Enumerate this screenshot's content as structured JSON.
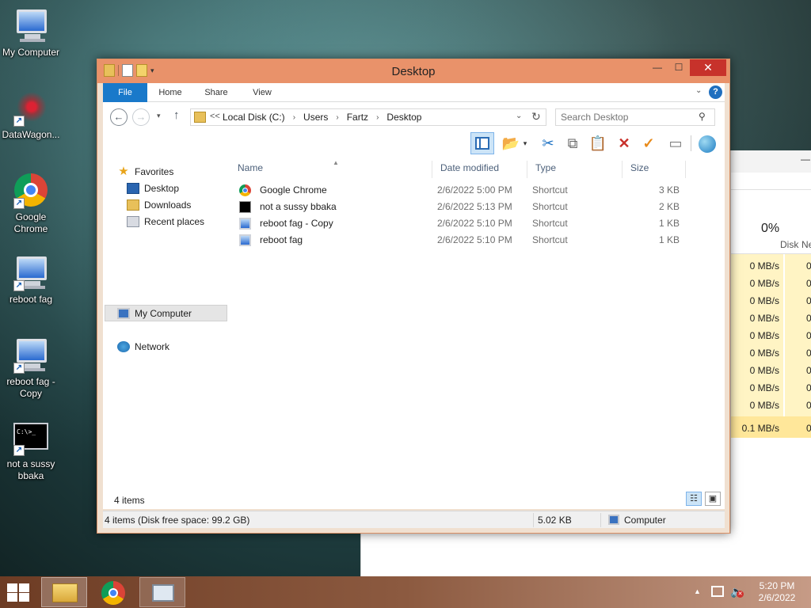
{
  "desktop": {
    "icons": [
      {
        "label": "My Computer",
        "icon": "computer-icon"
      },
      {
        "label": "DataWagon...",
        "icon": "virus-icon"
      },
      {
        "label": "Google Chrome",
        "icon": "chrome-icon"
      },
      {
        "label": "reboot fag",
        "icon": "computer-icon"
      },
      {
        "label": "reboot fag - Copy",
        "icon": "computer-icon"
      },
      {
        "label": "not a sussy bbaka",
        "icon": "cmd-icon"
      }
    ],
    "cmd_prompt_text": "C:\\>_"
  },
  "explorer": {
    "title": "Desktop",
    "ribbon_tabs": [
      "File",
      "Home",
      "Share",
      "View"
    ],
    "help_label": "?",
    "address": {
      "prefix": "<<",
      "crumbs": [
        "Local Disk (C:)",
        "Users",
        "Fartz",
        "Desktop"
      ]
    },
    "search_placeholder": "Search Desktop",
    "nav_pane": {
      "favorites_label": "Favorites",
      "favorites": [
        "Desktop",
        "Downloads",
        "Recent places"
      ],
      "computer_label": "My Computer",
      "network_label": "Network"
    },
    "columns": [
      "Name",
      "Date modified",
      "Type",
      "Size"
    ],
    "files": [
      {
        "name": "Google Chrome",
        "date": "2/6/2022 5:00 PM",
        "type": "Shortcut",
        "size": "3 KB",
        "icon": "chrome-icon"
      },
      {
        "name": "not a sussy bbaka",
        "date": "2/6/2022 5:13 PM",
        "type": "Shortcut",
        "size": "2 KB",
        "icon": "cmd-icon"
      },
      {
        "name": "reboot fag - Copy",
        "date": "2/6/2022 5:10 PM",
        "type": "Shortcut",
        "size": "1 KB",
        "icon": "computer-icon"
      },
      {
        "name": "reboot fag",
        "date": "2/6/2022 5:10 PM",
        "type": "Shortcut",
        "size": "1 KB",
        "icon": "computer-icon"
      }
    ],
    "item_count": "4 items",
    "status": {
      "summary": "4 items (Disk free space: 99.2 GB)",
      "size": "5.02 KB",
      "location": "Computer"
    }
  },
  "task_manager": {
    "disk_percent": "0%",
    "disk_label": "Disk",
    "net_label": "Ne",
    "disk_rows": [
      "0 MB/s",
      "0 MB/s",
      "0 MB/s",
      "0 MB/s",
      "0 MB/s",
      "0 MB/s",
      "0 MB/s",
      "0 MB/s",
      "0 MB/s",
      "0.1 MB/s"
    ],
    "net_rows": [
      "0",
      "0",
      "0",
      "0",
      "0",
      "0",
      "0",
      "0",
      "0",
      "0"
    ]
  },
  "taskbar": {
    "time": "5:20 PM",
    "date": "2/6/2022"
  },
  "colors": {
    "title_bar": "#e9926a",
    "file_tab": "#1979ca",
    "close_button": "#c7322b",
    "taskbar": "#8c5a40"
  }
}
